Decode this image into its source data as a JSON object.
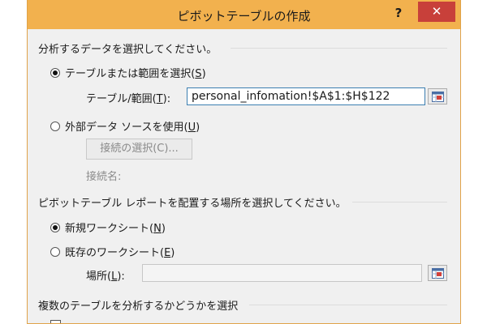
{
  "dialog": {
    "title": "ピボットテーブルの作成",
    "help_label": "?",
    "close_label": "✕"
  },
  "section1": {
    "heading": "分析するデータを選択してください。",
    "opt_table": {
      "label": "テーブルまたは範囲を選択(",
      "key": "S",
      "tail": ")",
      "selected": true
    },
    "range_label": {
      "label": "テーブル/範囲(",
      "key": "T",
      "tail": "):"
    },
    "range_value": "personal_infomation!$A$1:$H$122",
    "opt_external": {
      "label": "外部データ ソースを使用(",
      "key": "U",
      "tail": ")",
      "selected": false
    },
    "connect_button": "接続の選択(C)...",
    "connection_name_label": "接続名:"
  },
  "section2": {
    "heading": "ピボットテーブル レポートを配置する場所を選択してください。",
    "opt_new": {
      "label": "新規ワークシート(",
      "key": "N",
      "tail": ")",
      "selected": true
    },
    "opt_existing": {
      "label": "既存のワークシート(",
      "key": "E",
      "tail": ")",
      "selected": false
    },
    "location_label": {
      "label": "場所(",
      "key": "L",
      "tail": "):"
    },
    "location_value": ""
  },
  "section3": {
    "heading": "複数のテーブルを分析するかどうかを選択"
  },
  "colors": {
    "titlebar": "#f2b14e",
    "close": "#c8403a",
    "field_border": "#3c7fb1"
  }
}
